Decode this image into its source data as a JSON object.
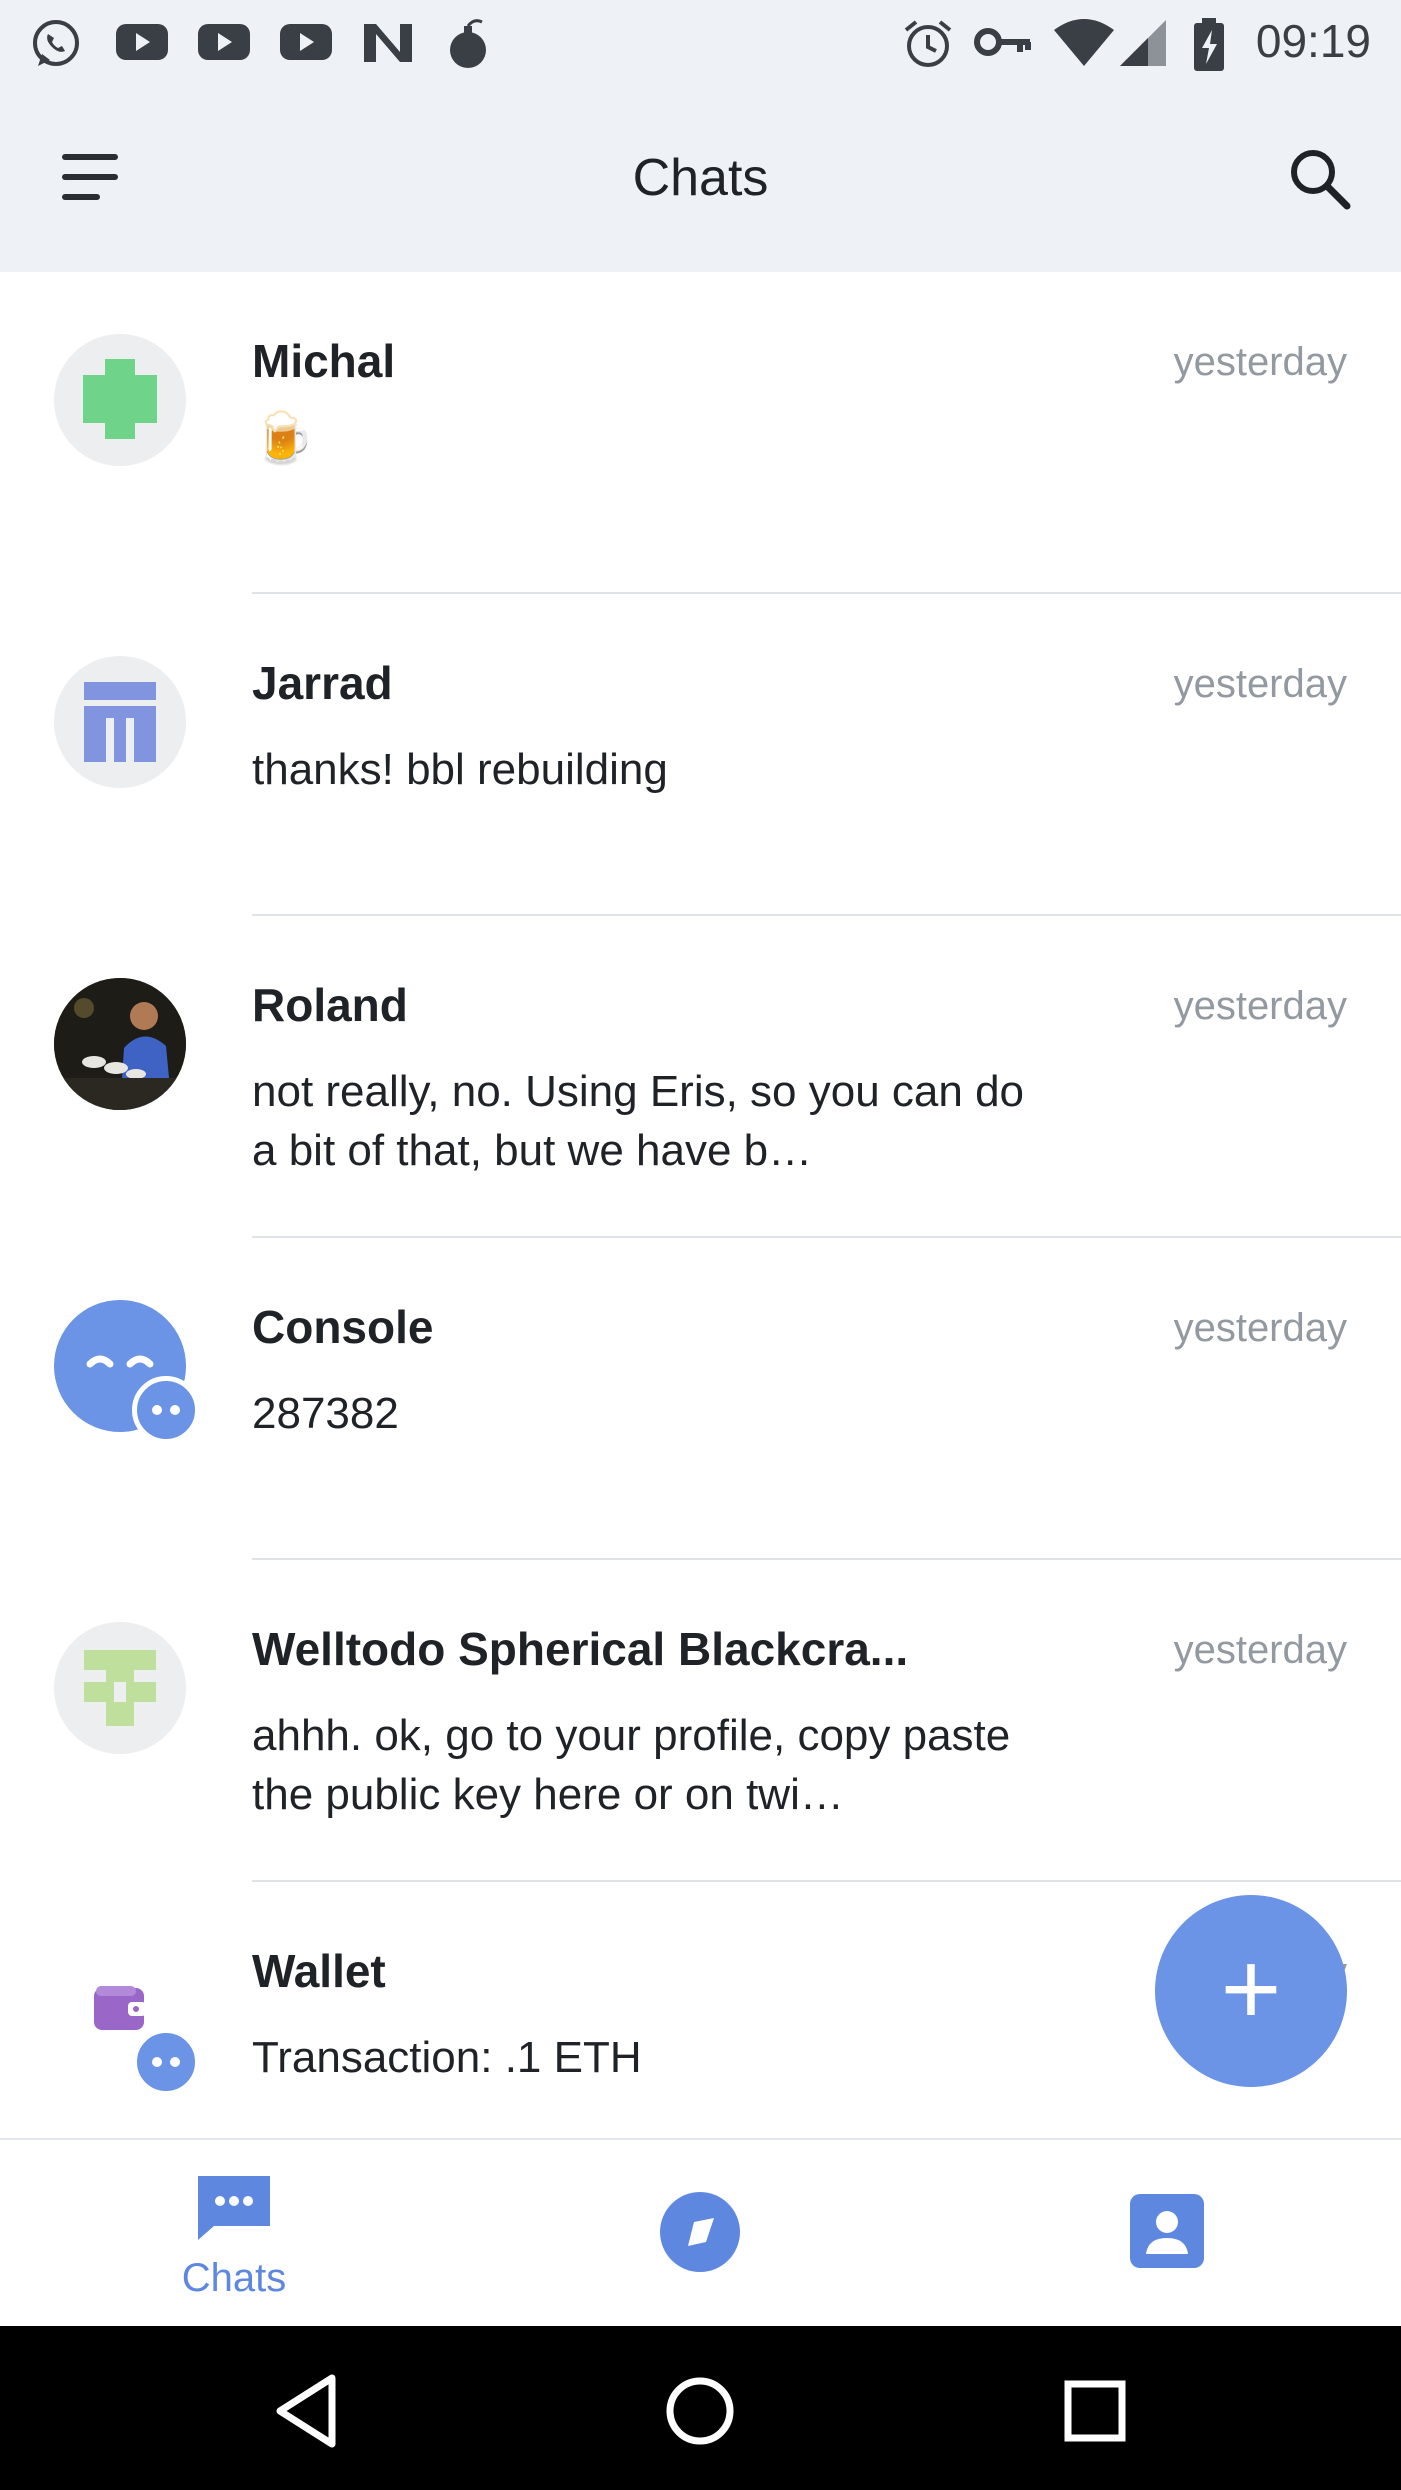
{
  "status_bar": {
    "time": "09:19",
    "left_icons": [
      "whatsapp-icon",
      "youtube-icon",
      "youtube-icon",
      "youtube-icon",
      "n-app-icon",
      "bomb-icon"
    ],
    "right_icons": [
      "alarm-icon",
      "key-icon",
      "wifi-icon",
      "signal-icon",
      "battery-charging-icon"
    ]
  },
  "appbar": {
    "title": "Chats"
  },
  "chats": [
    {
      "name": "Michal",
      "time": "yesterday",
      "message": "🍺",
      "avatar": "identicon-green"
    },
    {
      "name": "Jarrad",
      "time": "yesterday",
      "message": "thanks! bbl rebuilding",
      "avatar": "identicon-blue"
    },
    {
      "name": "Roland",
      "time": "yesterday",
      "message": "not really, no. Using Eris, so you can do a bit of that, but we have b…",
      "avatar": "photo"
    },
    {
      "name": "Console",
      "time": "yesterday",
      "message": "287382",
      "avatar": "console-bot"
    },
    {
      "name": "Welltodo Spherical Blackcra...",
      "time": "yesterday",
      "message": "ahhh. ok, go to your profile, copy paste the public key here or on twi…",
      "avatar": "identicon-lime"
    },
    {
      "name": "Wallet",
      "time": "yesterday",
      "message": "Transaction: .1 ETH",
      "avatar": "wallet-bot"
    }
  ],
  "fab": {
    "label": "+"
  },
  "bottom_nav": {
    "chats_label": "Chats",
    "items": [
      "chats-icon",
      "discover-icon",
      "profile-icon"
    ]
  },
  "colors": {
    "accent": "#6b93e6",
    "header_bg": "#eef1f5",
    "divider": "#dfe3e8",
    "secondary_text": "#9399a0"
  }
}
